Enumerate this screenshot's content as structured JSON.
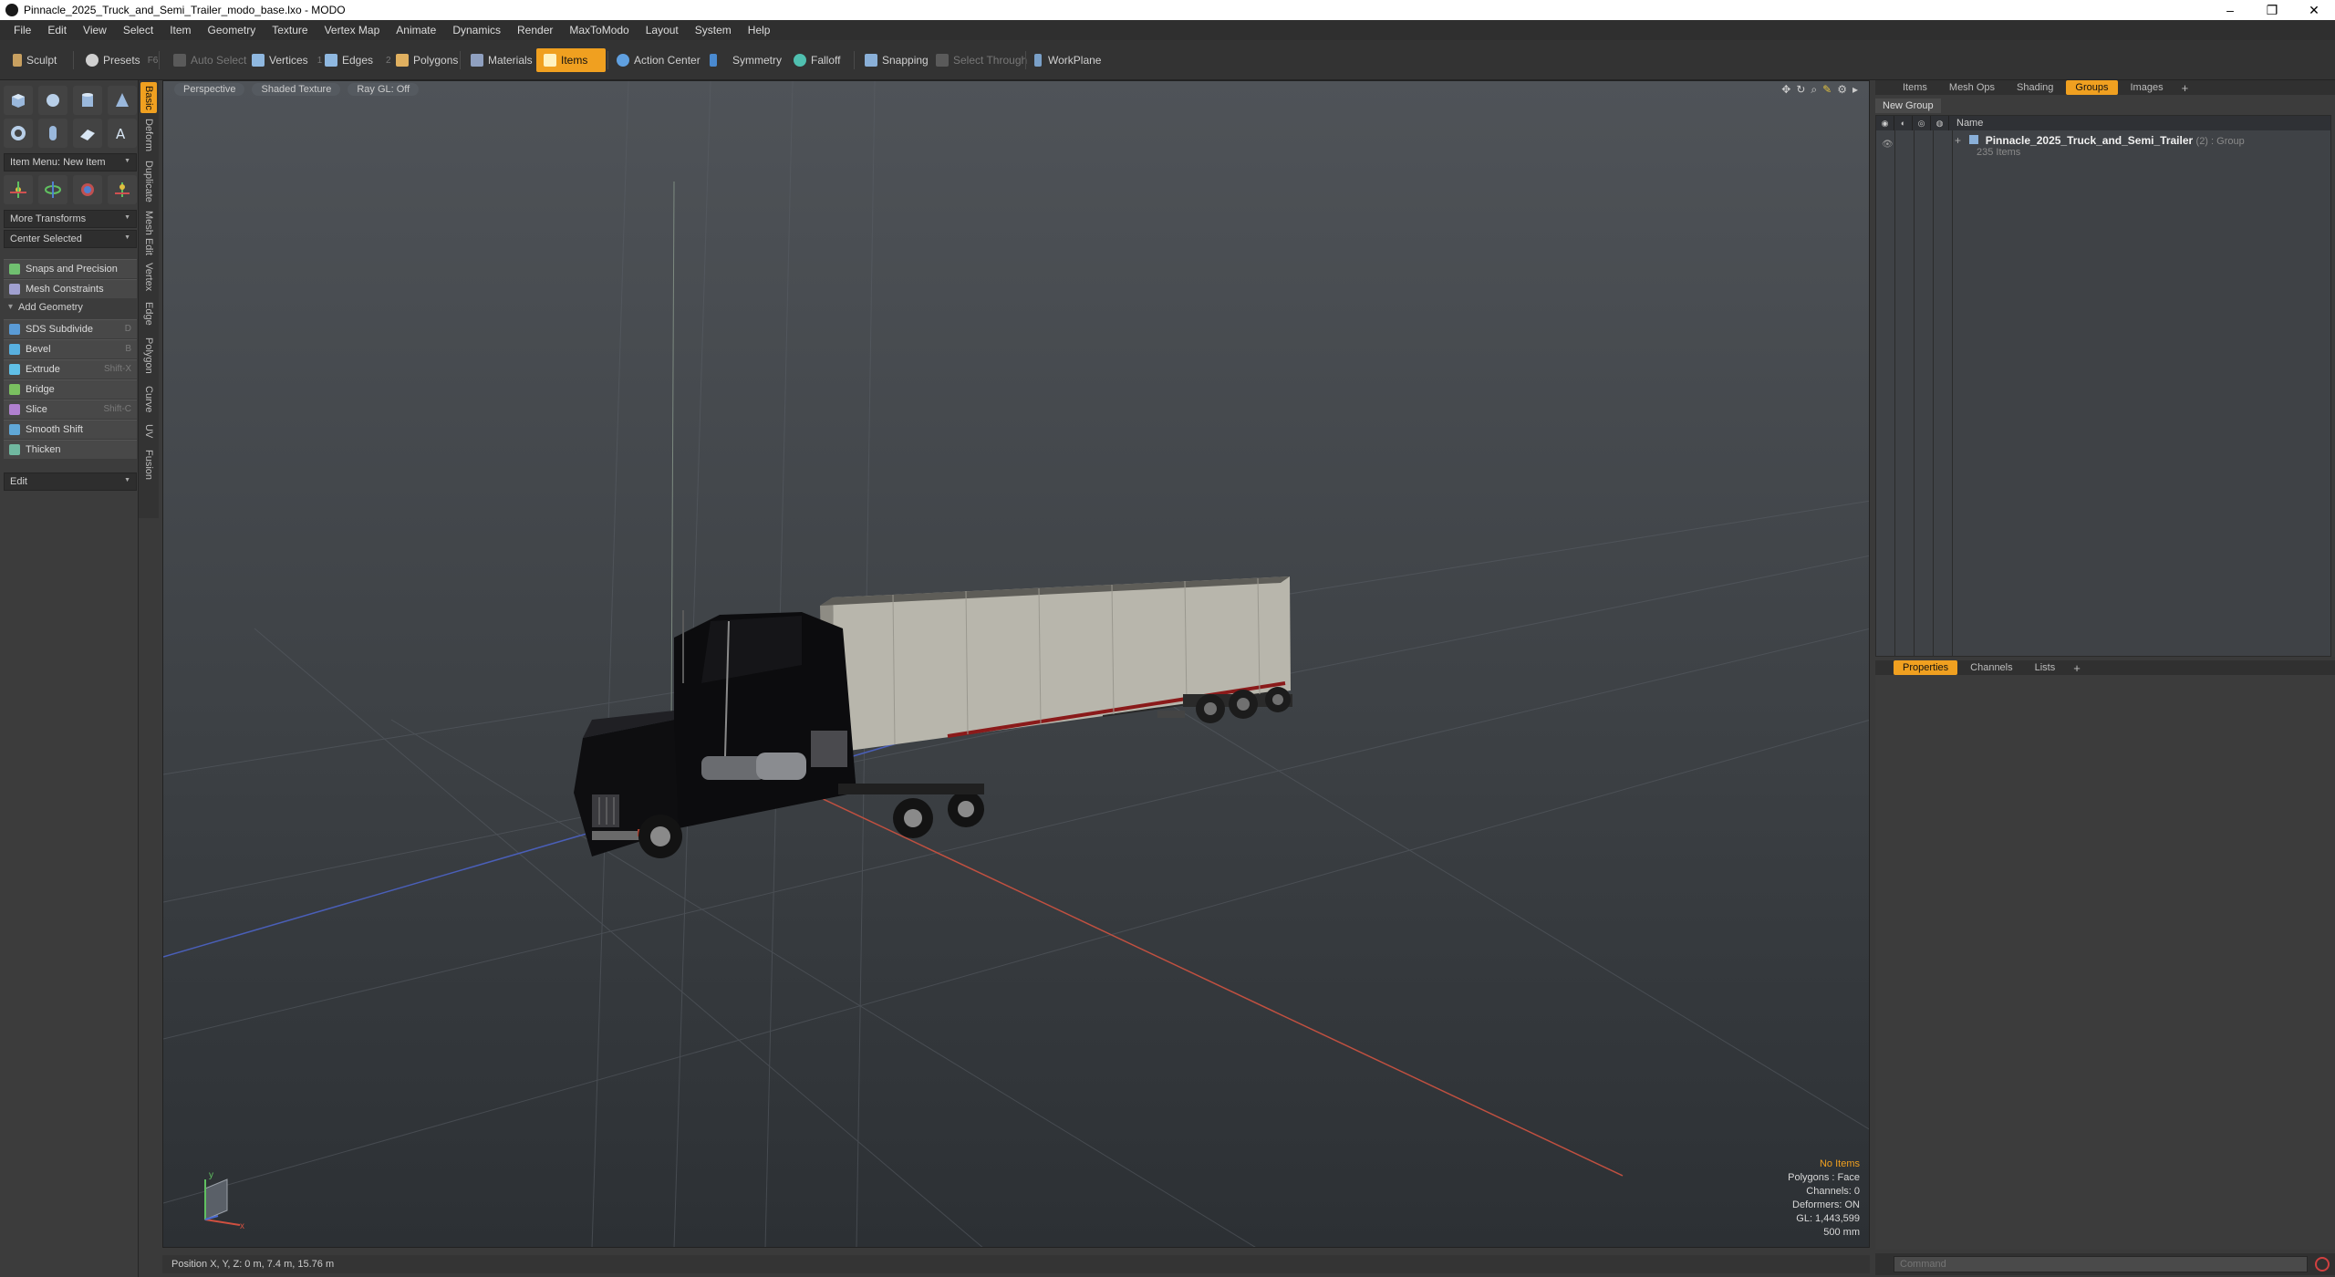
{
  "window": {
    "title": "Pinnacle_2025_Truck_and_Semi_Trailer_modo_base.lxo - MODO",
    "controls": [
      "–",
      "❐",
      "✕"
    ]
  },
  "menu": [
    "File",
    "Edit",
    "View",
    "Select",
    "Item",
    "Geometry",
    "Texture",
    "Vertex Map",
    "Animate",
    "Dynamics",
    "Render",
    "MaxToModo",
    "Layout",
    "System",
    "Help"
  ],
  "toolbar": {
    "sculpt": "Sculpt",
    "presets": "Presets",
    "presets_key": "F6",
    "auto_select": "Auto Select",
    "vertices": "Vertices",
    "vertices_key": "1",
    "edges": "Edges",
    "edges_key": "2",
    "polygons": "Polygons",
    "materials": "Materials",
    "items": "Items",
    "action_center": "Action Center",
    "symmetry": "Symmetry",
    "falloff": "Falloff",
    "snapping": "Snapping",
    "select_through": "Select Through",
    "workplane": "WorkPlane"
  },
  "left": {
    "vtabs": [
      "Basic",
      "Deform",
      "Duplicate",
      "Mesh Edit",
      "Vertex",
      "Edge",
      "Polygon",
      "Curve",
      "UV",
      "Fusion"
    ],
    "item_menu": "Item Menu: New Item",
    "more_transforms": "More Transforms",
    "center_selected": "Center Selected",
    "snaps": "Snaps and Precision",
    "mesh_constraints": "Mesh Constraints",
    "add_geometry": "Add Geometry",
    "tools": [
      {
        "label": "SDS Subdivide",
        "key": "D",
        "color": "#5a9bd6"
      },
      {
        "label": "Bevel",
        "key": "B",
        "color": "#58b0e0"
      },
      {
        "label": "Extrude",
        "key": "Shift-X",
        "color": "#60c0e8"
      },
      {
        "label": "Bridge",
        "key": "",
        "color": "#7ac060"
      },
      {
        "label": "Slice",
        "key": "Shift-C",
        "color": "#b080d0"
      },
      {
        "label": "Smooth Shift",
        "key": "",
        "color": "#60a8d8"
      },
      {
        "label": "Thicken",
        "key": "",
        "color": "#70b8a0"
      }
    ],
    "edit": "Edit"
  },
  "viewport": {
    "perspective": "Perspective",
    "shading": "Shaded Texture",
    "raygl": "Ray GL: Off",
    "stats": {
      "items": "No Items",
      "polygons": "Polygons : Face",
      "channels": "Channels: 0",
      "deformers": "Deformers: ON",
      "gl": "GL: 1,443,599",
      "scale": "500 mm"
    },
    "position": "Position X, Y, Z:   0 m, 7.4 m, 15.76 m"
  },
  "right": {
    "tabs": [
      "Items",
      "Mesh Ops",
      "Shading",
      "Groups",
      "Images"
    ],
    "active_tab": "Groups",
    "new_group": "New Group",
    "name_header": "Name",
    "group_name": "Pinnacle_2025_Truck_and_Semi_Trailer",
    "group_suffix": "(2) : Group",
    "group_count": "235 Items",
    "bottom_tabs": [
      "Properties",
      "Channels",
      "Lists"
    ],
    "bottom_active": "Properties",
    "command_placeholder": "Command"
  },
  "colors": {
    "accent": "#f0a020",
    "x_axis": "#d05040",
    "z_axis": "#4060c0"
  }
}
